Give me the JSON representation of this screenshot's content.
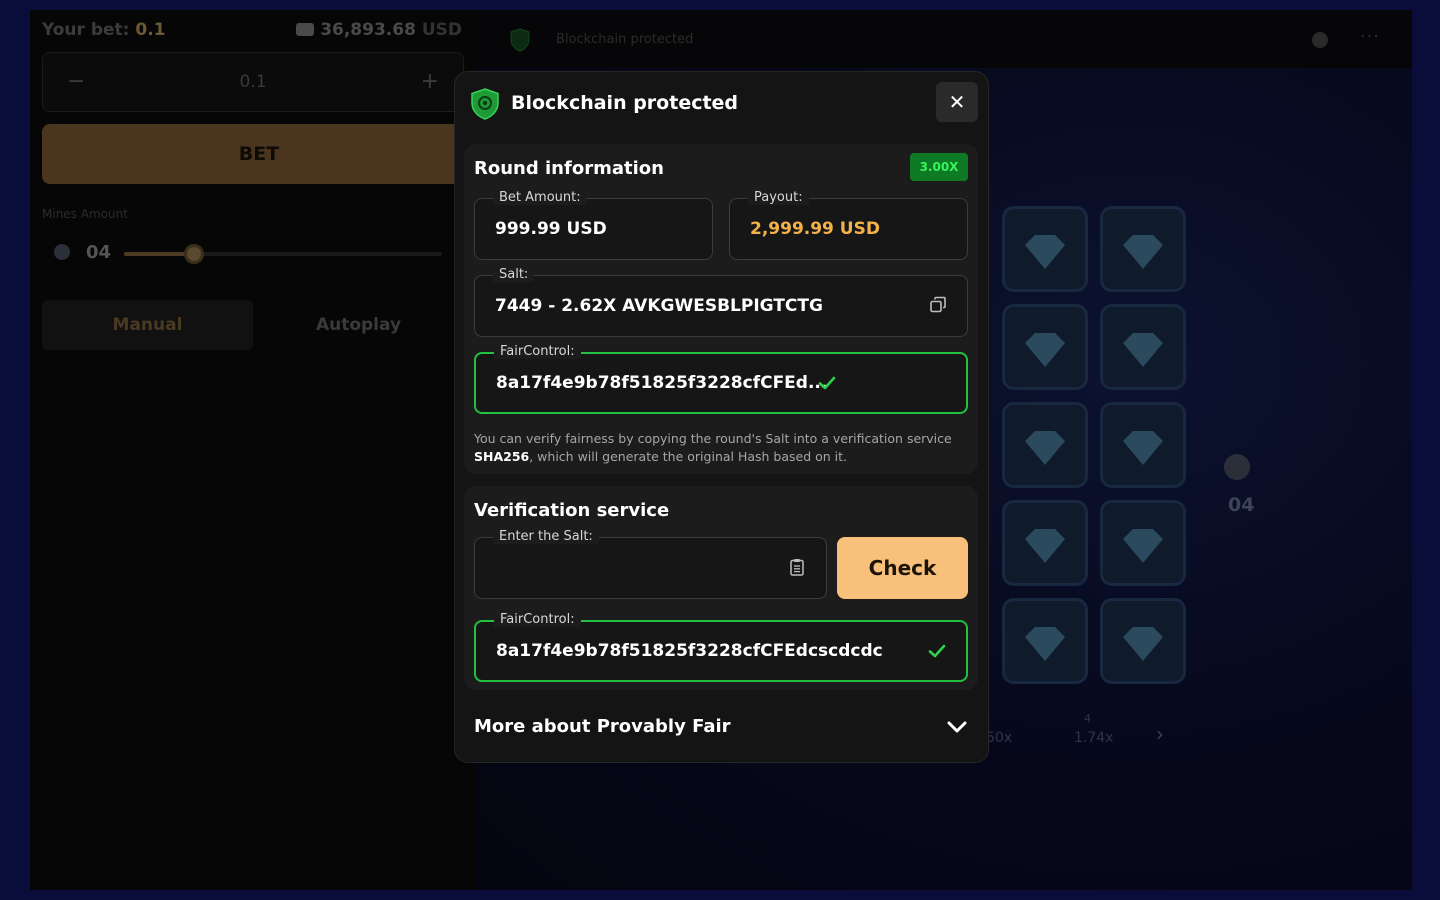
{
  "background": {
    "bet_label": "Your bet:",
    "bet_value": "0.1",
    "balance_value": "36,893.68",
    "balance_currency": "USD",
    "stepper_minus": "−",
    "stepper_amount": "0.1",
    "stepper_plus": "+",
    "bet_button": "BET",
    "mines_label": "Mines Amount",
    "mines_count": "04",
    "mines_slider_fraction": 0.22,
    "tabs": [
      "Manual",
      "Autoplay"
    ],
    "header_title": "Blockchain protected",
    "header_dots": "···",
    "side_mines_count": "04",
    "multipliers": [
      "50x",
      "1.74x"
    ],
    "multiplier_mines": "4",
    "next_arrow": "›"
  },
  "modal": {
    "title": "Blockchain protected",
    "close_symbol": "✕",
    "round": {
      "title": "Round information",
      "multiplier": "3.00X",
      "bet_label": "Bet Amount:",
      "bet_value": "999.99 USD",
      "payout_label": "Payout:",
      "payout_value": "2,999.99 USD",
      "salt_label": "Salt:",
      "salt_value": "7449 - 2.62X AVKGWESBLPIGTCTG",
      "fair_label": "FairControl:",
      "fair_value": "8a17f4e9b78f51825f3228cfCFEd...",
      "info_prefix": "You can verify fairness by copying the round's Salt into a verification service ",
      "info_bold": "SHA256",
      "info_suffix": ", which will generate the original Hash based on it."
    },
    "verify": {
      "title": "Verification service",
      "salt_label": "Enter the Salt:",
      "salt_input_value": "",
      "check_button": "Check",
      "fair_label": "FairControl:",
      "fair_value": "8a17f4e9b78f51825f3228cfCFEdcscdcdc"
    },
    "more_label": "More about Provably Fair"
  },
  "colors": {
    "accent_gold": "#f8c07a",
    "success_green": "#23c13f",
    "payout_gold": "#f5b24a"
  },
  "icons": [
    "shield-icon",
    "close-icon",
    "copy-icon",
    "check-icon",
    "clipboard-icon",
    "chevron-down-icon",
    "gem-icon",
    "bomb-icon",
    "wallet-icon",
    "clock-icon"
  ]
}
